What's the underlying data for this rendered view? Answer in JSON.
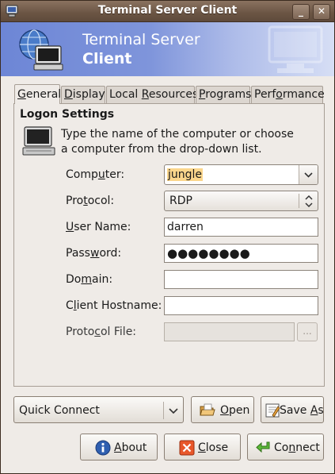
{
  "window": {
    "title": "Terminal Server Client",
    "minimize_glyph": "_",
    "close_glyph": "✕"
  },
  "banner": {
    "line1": "Terminal Server",
    "line2": "Client"
  },
  "tabs": [
    {
      "label": "General",
      "mnemonic": "G",
      "rest": "eneral",
      "active": true
    },
    {
      "label": "Display",
      "mnemonic": "D",
      "rest": "isplay",
      "active": false
    },
    {
      "label": "Local Resources",
      "pre": "Local ",
      "mnemonic": "R",
      "rest": "esources",
      "active": false
    },
    {
      "label": "Programs",
      "mnemonic": "P",
      "rest": "rograms",
      "active": false
    },
    {
      "label": "Performance",
      "pre": "Perf",
      "mnemonic": "o",
      "rest": "rmance",
      "active": false
    }
  ],
  "logon": {
    "section_title": "Logon Settings",
    "intro": "Type the name of the computer or choose a computer from the drop-down list.",
    "fields": {
      "computer": {
        "label_pre": "Comp",
        "label_mn": "u",
        "label_post": "ter:",
        "value": "jungle"
      },
      "protocol": {
        "label_pre": "Pro",
        "label_mn": "t",
        "label_post": "ocol:",
        "value": "RDP"
      },
      "username": {
        "label_pre": "",
        "label_mn": "U",
        "label_post": "ser Name:",
        "value": "darren"
      },
      "password": {
        "label_pre": "Pass",
        "label_mn": "w",
        "label_post": "ord:",
        "value": "●●●●●●●●"
      },
      "domain": {
        "label_pre": "Do",
        "label_mn": "m",
        "label_post": "ain:",
        "value": ""
      },
      "client_hostname": {
        "label_pre": "C",
        "label_mn": "l",
        "label_post": "ient Hostname:",
        "value": ""
      },
      "protocol_file": {
        "label_pre": "Proto",
        "label_mn": "c",
        "label_post": "ol File:",
        "value": ""
      }
    },
    "browse_label": "..."
  },
  "bottom": {
    "quick_connect": "Quick Connect",
    "open": {
      "mn": "O",
      "rest": "pen"
    },
    "save_as": {
      "pre": "Save ",
      "mn": "A",
      "rest": "s"
    },
    "about": {
      "mn": "A",
      "rest": "bout"
    },
    "close": {
      "mn": "C",
      "rest": "lose"
    },
    "connect": {
      "pre": "Co",
      "mn": "n",
      "rest": "nect"
    }
  },
  "colors": {
    "title_bar": "#6b5544",
    "banner_start": "#6d86d6",
    "highlight": "#fbd68c",
    "window_bg": "#efebe7"
  },
  "icons": {
    "title": "terminal-monitor-icon",
    "banner": "computer-globe-icon",
    "intro": "computer-icon",
    "about": "info-icon",
    "close": "close-icon",
    "connect": "arrow-icon",
    "open": "open-folder-icon",
    "save": "save-icon"
  }
}
